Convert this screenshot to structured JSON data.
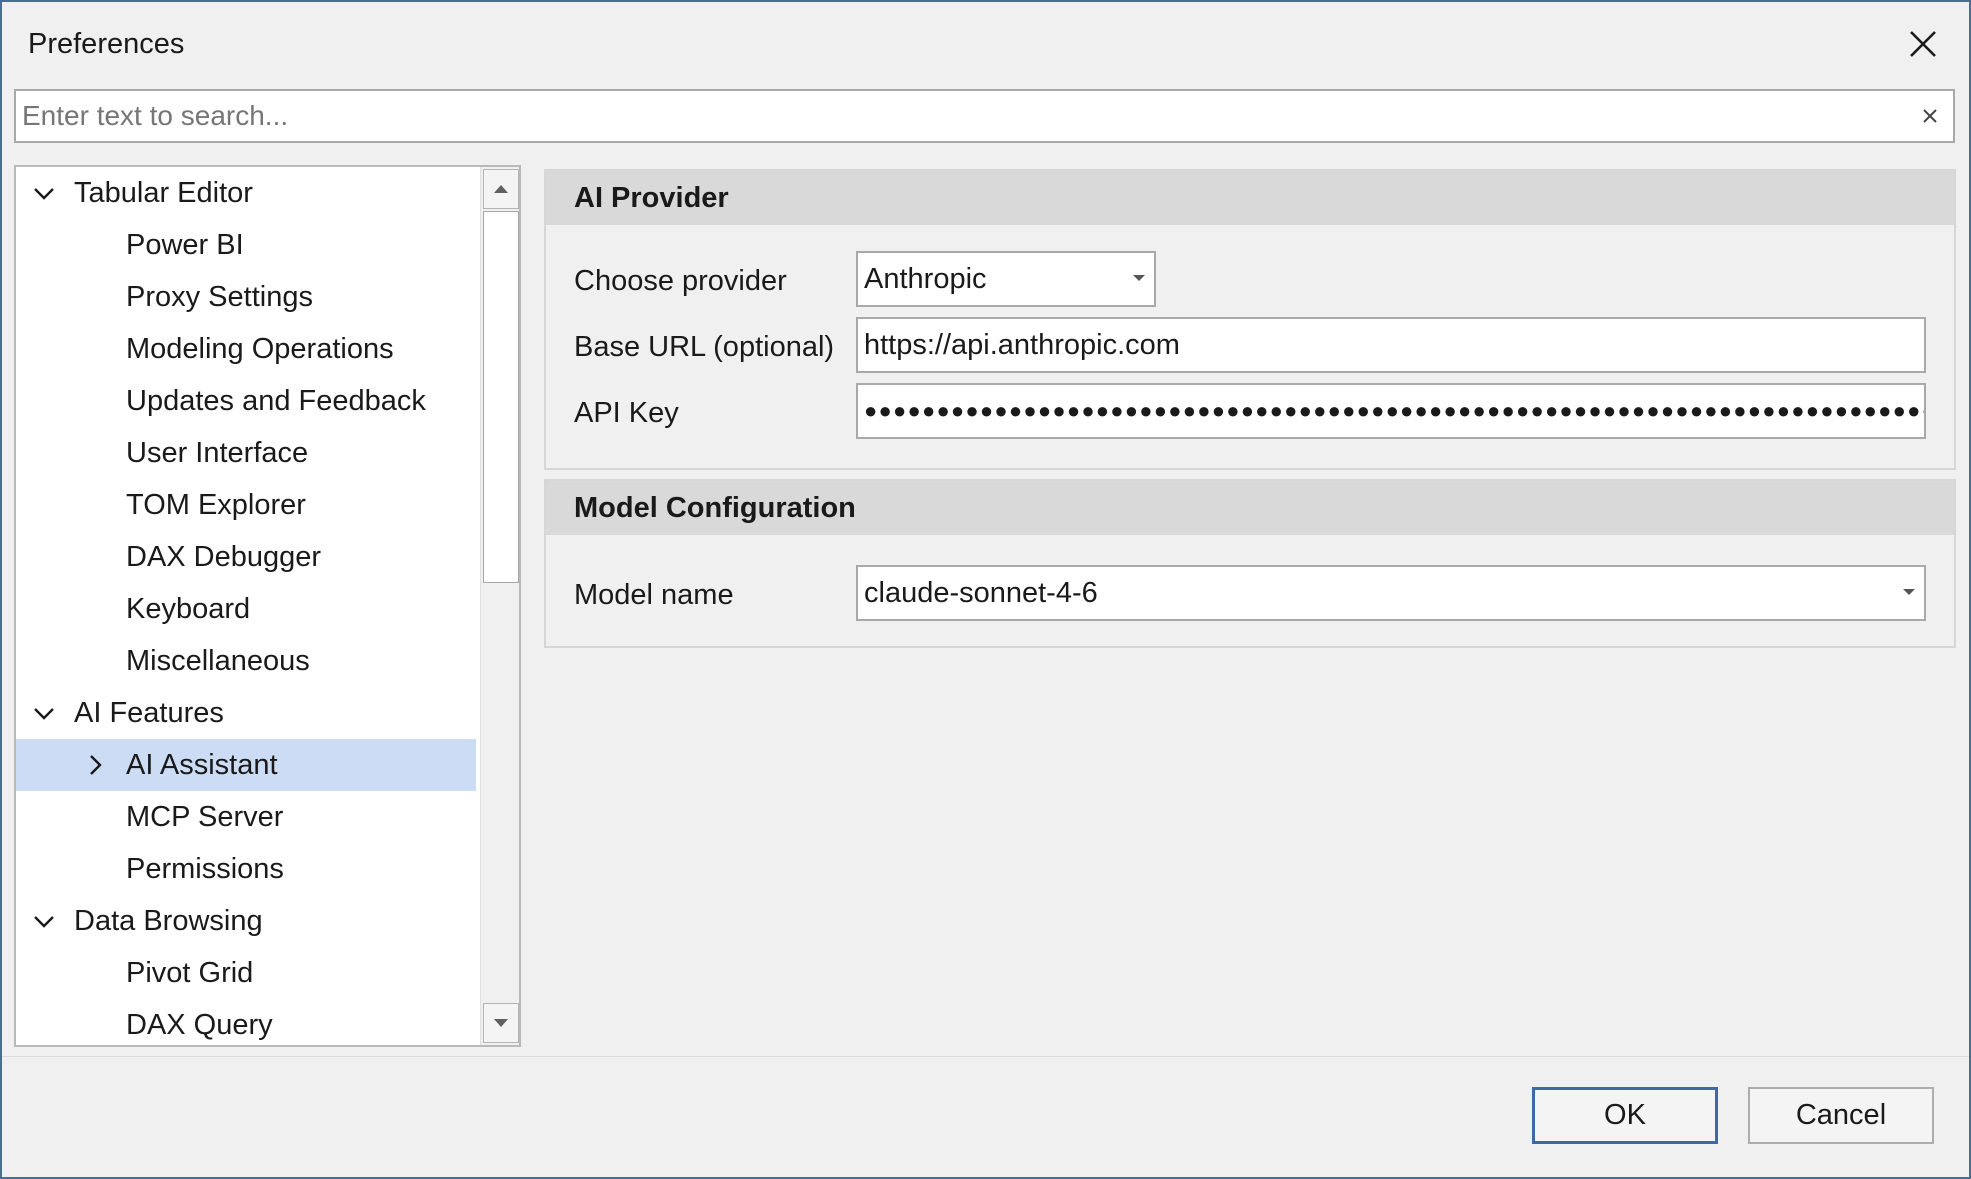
{
  "window": {
    "title": "Preferences"
  },
  "search": {
    "placeholder": "Enter text to search...",
    "value": ""
  },
  "tree": {
    "items": [
      {
        "label": "Tabular Editor",
        "level": 0,
        "expander": "chevron-down"
      },
      {
        "label": "Power BI",
        "level": 1
      },
      {
        "label": "Proxy Settings",
        "level": 1
      },
      {
        "label": "Modeling Operations",
        "level": 1
      },
      {
        "label": "Updates and Feedback",
        "level": 1
      },
      {
        "label": "User Interface",
        "level": 1
      },
      {
        "label": "TOM Explorer",
        "level": 1
      },
      {
        "label": "DAX Debugger",
        "level": 1
      },
      {
        "label": "Keyboard",
        "level": 1
      },
      {
        "label": "Miscellaneous",
        "level": 1
      },
      {
        "label": "AI Features",
        "level": 0,
        "expander": "chevron-down"
      },
      {
        "label": "AI Assistant",
        "level": 1,
        "expander": "chevron-right",
        "selected": true
      },
      {
        "label": "MCP Server",
        "level": 1
      },
      {
        "label": "Permissions",
        "level": 1
      },
      {
        "label": "Data Browsing",
        "level": 0,
        "expander": "chevron-down"
      },
      {
        "label": "Pivot Grid",
        "level": 1
      },
      {
        "label": "DAX Query",
        "level": 1
      }
    ]
  },
  "ai_provider": {
    "header": "AI Provider",
    "choose_provider_label": "Choose provider",
    "provider_value": "Anthropic",
    "base_url_label": "Base URL (optional)",
    "base_url_value": "https://api.anthropic.com",
    "api_key_label": "API Key",
    "api_key_masked": "●●●●●●●●●●●●●●●●●●●●●●●●●●●●●●●●●●●●●●●●●●●●●●●●●●●●●●●●●●●●●●●●●●●●●●●●●●●●●●"
  },
  "model_configuration": {
    "header": "Model Configuration",
    "model_name_label": "Model name",
    "model_name_value": "claude-sonnet-4-6"
  },
  "footer": {
    "ok_label": "OK",
    "cancel_label": "Cancel"
  },
  "colors": {
    "selection": "#cddcf5",
    "ok_border": "#3d6aa6",
    "window_border": "#4a6d93"
  }
}
